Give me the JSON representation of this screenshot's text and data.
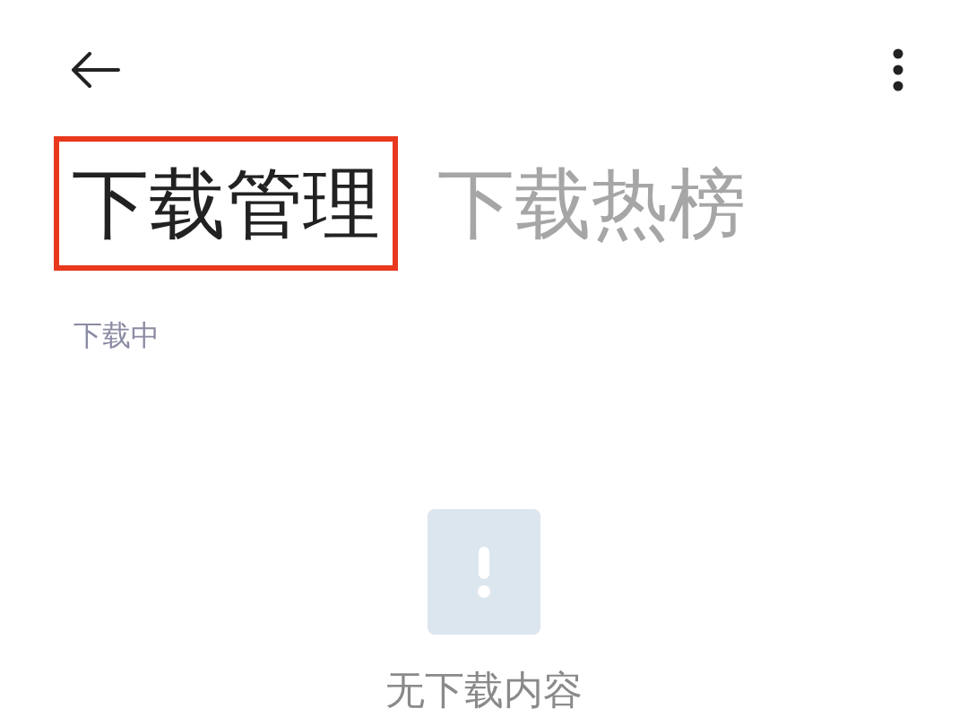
{
  "tabs": [
    {
      "label": "下载管理",
      "selected": true,
      "annotated": true
    },
    {
      "label": "下载热榜",
      "selected": false,
      "annotated": false
    }
  ],
  "section": {
    "title": "下载中"
  },
  "empty_state": {
    "message": "无下载内容"
  }
}
